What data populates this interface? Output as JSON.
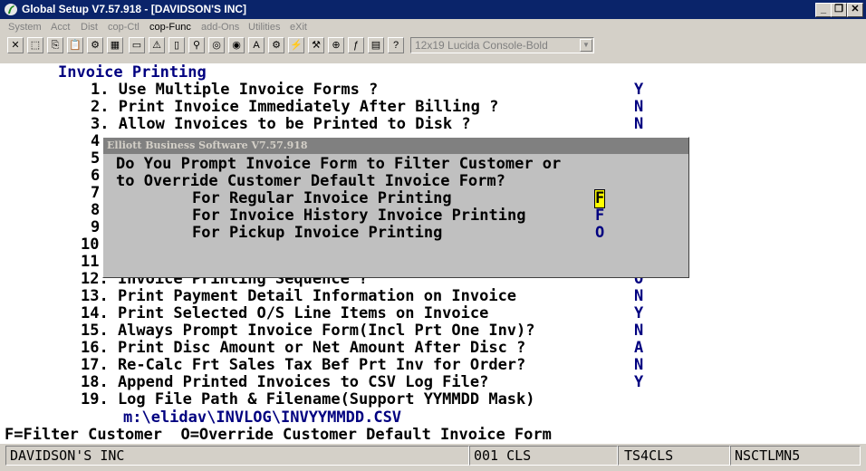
{
  "window": {
    "title": "Global Setup V7.57.918 - [DAVIDSON'S INC]",
    "minimize": "_",
    "restore": "❐",
    "close": "✕"
  },
  "menu": [
    "System",
    "Acct",
    "Dist",
    "cop-Ctl",
    "cop-Func",
    "add-Ons",
    "Utilities",
    "eXit"
  ],
  "menu_active": "cop-Func",
  "toolbar": {
    "icons": [
      "close-icon",
      "select-icon",
      "copy-icon",
      "paste-icon",
      "settings-icon",
      "calculator-icon",
      "form-icon",
      "warning-icon",
      "print-icon",
      "find-icon",
      "zoom-icon",
      "globe-icon",
      "font-icon",
      "gear-icon",
      "flash-icon",
      "calc-icon",
      "link-icon",
      "function-icon",
      "notes-icon",
      "help-icon"
    ],
    "glyphs": [
      "✕",
      "⬚",
      "⎘",
      "📋",
      "⚙",
      "▦",
      "▭",
      "⚠",
      "▯",
      "⚲",
      "◎",
      "◉",
      "A",
      "⚙",
      "⚡",
      "⚒",
      "⊕",
      "ƒ",
      "▤",
      "?"
    ],
    "font_select": "12x19 Lucida Console-Bold"
  },
  "screen": {
    "heading": "Invoice Printing",
    "items": [
      {
        "label": "1. Use Multiple Invoice Forms ?",
        "value": "Y"
      },
      {
        "label": "2. Print Invoice Immediately After Billing ?",
        "value": "N"
      },
      {
        "label": "3. Allow Invoices to be Printed to Disk ?",
        "value": "N"
      },
      {
        "label": "4",
        "value": ""
      },
      {
        "label": "5",
        "value": ""
      },
      {
        "label": "6",
        "value": ""
      },
      {
        "label": "7",
        "value": ""
      },
      {
        "label": "8",
        "value": ""
      },
      {
        "label": "9",
        "value": ""
      },
      {
        "label": "10",
        "value": ""
      },
      {
        "label": "11",
        "value": ""
      },
      {
        "label": "12. Invoice Printing Sequence ?",
        "value": "O"
      },
      {
        "label": "13. Print Payment Detail Information on Invoice",
        "value": "N"
      },
      {
        "label": "14. Print Selected O/S Line Items on Invoice",
        "value": "Y"
      },
      {
        "label": "15. Always Prompt Invoice Form(Incl Prt One Inv)?",
        "value": "N"
      },
      {
        "label": "16. Print Disc Amount or Net Amount After Disc ?",
        "value": "A"
      },
      {
        "label": "17. Re-Calc Frt Sales Tax Bef Prt Inv for Order?",
        "value": "N"
      },
      {
        "label": "18. Append Printed Invoices to CSV Log File?",
        "value": "Y"
      },
      {
        "label": "19. Log File Path & Filename(Support YYMMDD Mask)",
        "value": ""
      }
    ],
    "log_path": "m:\\elidav\\INVLOG\\INVYYMMDD.CSV"
  },
  "dialog": {
    "title": "Elliott Business Software V7.57.918",
    "question_line1": "Do You Prompt Invoice Form to Filter Customer or",
    "question_line2": "to Override Customer Default Invoice Form?",
    "options": [
      {
        "label": "For Regular Invoice Printing",
        "value": "F"
      },
      {
        "label": "For Invoice History Invoice Printing",
        "value": "F"
      },
      {
        "label": "For Pickup Invoice Printing",
        "value": "O"
      }
    ]
  },
  "help_line": "F=Filter Customer  O=Override Customer Default Invoice Form",
  "status": {
    "company": "DAVIDSON'S INC",
    "code": "001 CLS",
    "terminal": "TS4CLS",
    "program": "NSCTLMN5"
  },
  "colors": {
    "titlebar": "#0a246a",
    "text_blue": "#000080",
    "focus_highlight": "#ffff00"
  }
}
